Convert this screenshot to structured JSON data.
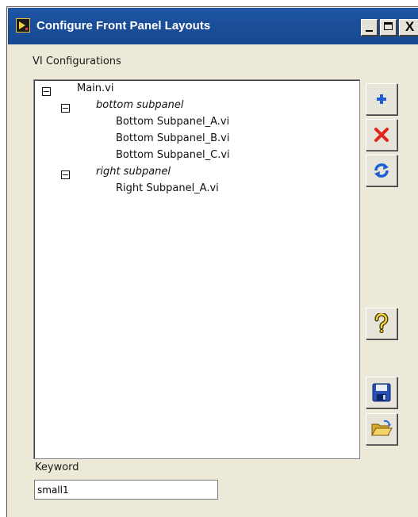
{
  "window": {
    "title": "Configure Front Panel Layouts"
  },
  "title_buttons": {
    "minimize": "_",
    "maximize": "□",
    "close": "X"
  },
  "vi_configurations": {
    "label": "VI Configurations",
    "tree": [
      {
        "label": "Main.vi",
        "italic": false,
        "expanded": true
      },
      {
        "label": "bottom subpanel",
        "italic": true,
        "expanded": true
      },
      {
        "label": "Bottom Subpanel_A.vi",
        "italic": false
      },
      {
        "label": "Bottom Subpanel_B.vi",
        "italic": false
      },
      {
        "label": "Bottom Subpanel_C.vi",
        "italic": false
      },
      {
        "label": "right subpanel",
        "italic": true,
        "expanded": true
      },
      {
        "label": "Right Subpanel_A.vi",
        "italic": false
      }
    ]
  },
  "toolbar": {
    "add_icon": "plus-icon",
    "delete_icon": "red-x-icon",
    "refresh_icon": "refresh-icon",
    "help_icon": "help-question-icon",
    "save_icon": "floppy-disk-icon",
    "open_icon": "open-folder-icon"
  },
  "keyword": {
    "label": "Keyword",
    "value": "small1"
  },
  "colors": {
    "titlebar": "#1a4d98",
    "window_bg": "#ece9d8",
    "add_blue": "#1c5ed6",
    "delete_red": "#e3241b",
    "help_yellow": "#f0d23c"
  }
}
